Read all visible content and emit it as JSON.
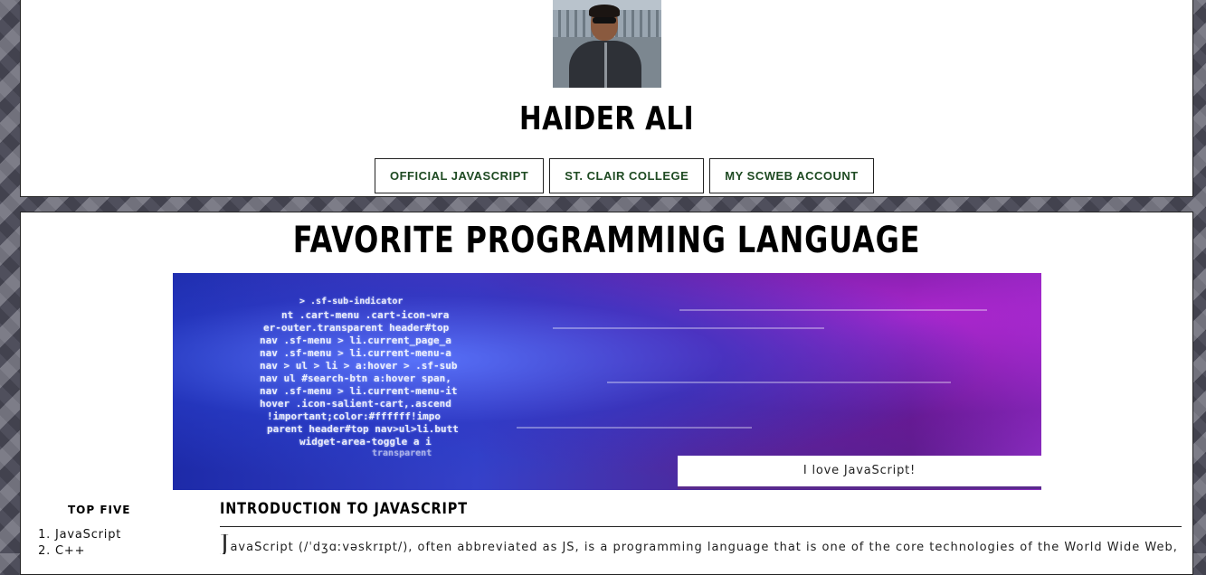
{
  "header": {
    "name": "HAIDER ALI",
    "nav": [
      {
        "label": "OFFICIAL JAVASCRIPT"
      },
      {
        "label": "ST. CLAIR COLLEGE"
      },
      {
        "label": "MY SCWEB ACCOUNT"
      }
    ]
  },
  "main": {
    "title": "FAVORITE PROGRAMMING LANGUAGE",
    "hero": {
      "code_lines": [
        "> .sf-sub-indicator",
        "nt .cart-menu .cart-icon-wra",
        "er-outer.transparent header#top",
        "nav .sf-menu > li.current_page_a",
        "nav .sf-menu > li.current-menu-a",
        "nav > ul > li > a:hover > .sf-sub",
        "nav ul #search-btn a:hover span,",
        "nav .sf-menu > li.current-menu-it",
        "hover .icon-salient-cart,.ascend",
        "!important;color:#ffffff!impo",
        "parent header#top nav>ul>li.butt",
        "widget-area-toggle a i",
        "transparent"
      ],
      "caption": "I love JavaScript!"
    },
    "sidebar": {
      "title": "TOP FIVE",
      "items": [
        "JavaScript",
        "C++"
      ]
    },
    "article": {
      "heading": "INTRODUCTION TO JAVASCRIPT",
      "drop_cap": "J",
      "text": "avaScript (/ˈdʒɑːvəskrɪpt/), often abbreviated as JS, is a programming language that is one of the core technologies of the World Wide Web,"
    }
  }
}
